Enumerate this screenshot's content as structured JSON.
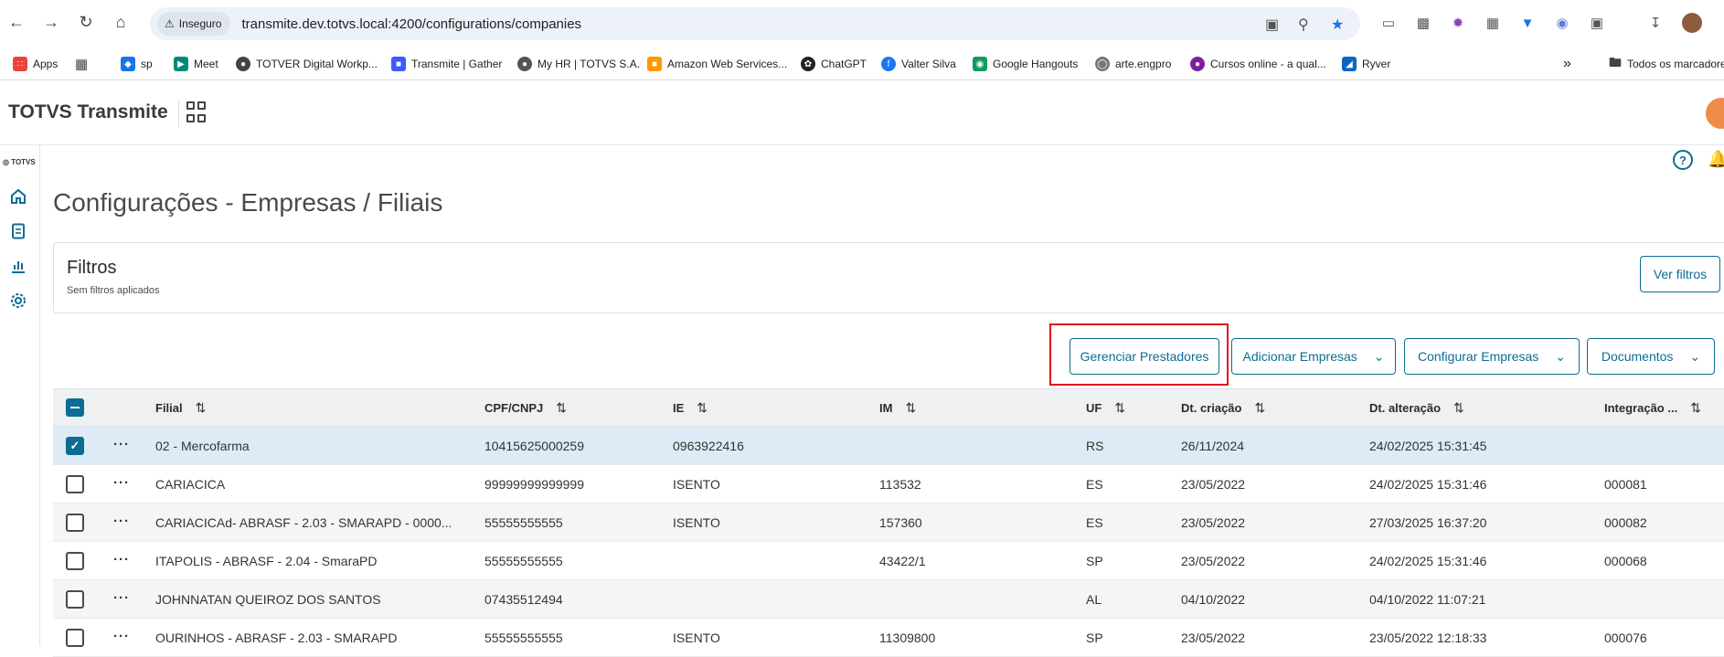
{
  "browser": {
    "security_label": "Inseguro",
    "url": "transmite.dev.totvs.local:4200/configurations/companies",
    "bookmarks": [
      {
        "label": "Apps",
        "color": "#e8453c"
      },
      {
        "label": "sp",
        "color": "#1a73e8"
      },
      {
        "label": "Meet",
        "color": "#00897b"
      },
      {
        "label": "TOTVER Digital Workp...",
        "color": "#444444"
      },
      {
        "label": "Transmite | Gather",
        "color": "#3d5afe"
      },
      {
        "label": "My HR | TOTVS S.A.",
        "color": "#555555"
      },
      {
        "label": "Amazon Web Services...",
        "color": "#ff9900"
      },
      {
        "label": "ChatGPT",
        "color": "#222222"
      },
      {
        "label": "Valter Silva",
        "color": "#1877f2"
      },
      {
        "label": "Google Hangouts",
        "color": "#0f9d58"
      },
      {
        "label": "arte.engpro",
        "color": "#777777"
      },
      {
        "label": "Cursos online - a qual...",
        "color": "#7b1fa2"
      },
      {
        "label": "Ryver",
        "color": "#0a66c2"
      }
    ],
    "bookmarks_folder": "Todos os marcadores"
  },
  "app": {
    "title": "TOTVS Transmite",
    "side_logo": "TOTVS"
  },
  "page": {
    "title": "Configurações - Empresas / Filiais"
  },
  "filters": {
    "title": "Filtros",
    "subtitle": "Sem filtros aplicados",
    "view_button": "Ver filtros"
  },
  "actions": {
    "manage_providers": "Gerenciar Prestadores",
    "add_companies": "Adicionar Empresas",
    "configure_companies": "Configurar Empresas",
    "documents": "Documentos"
  },
  "table": {
    "columns": [
      "Filial",
      "CPF/CNPJ",
      "IE",
      "IM",
      "UF",
      "Dt. criação",
      "Dt. alteração",
      "Integração ..."
    ],
    "rows": [
      {
        "filial": "02 - Mercofarma",
        "cnpj": "10415625000259",
        "ie": "0963922416",
        "im": "",
        "uf": "RS",
        "created": "26/11/2024",
        "updated": "24/02/2025 15:31:45",
        "integration": "",
        "selected": true
      },
      {
        "filial": "CARIACICA",
        "cnpj": "99999999999999",
        "ie": "ISENTO",
        "im": "113532",
        "uf": "ES",
        "created": "23/05/2022",
        "updated": "24/02/2025 15:31:46",
        "integration": "000081",
        "selected": false
      },
      {
        "filial": "CARIACICAd- ABRASF - 2.03 - SMARAPD - 0000...",
        "cnpj": "55555555555",
        "ie": "ISENTO",
        "im": "157360",
        "uf": "ES",
        "created": "23/05/2022",
        "updated": "27/03/2025 16:37:20",
        "integration": "000082",
        "selected": false
      },
      {
        "filial": "ITAPOLIS - ABRASF - 2.04 - SmaraPD",
        "cnpj": "55555555555",
        "ie": "",
        "im": "43422/1",
        "uf": "SP",
        "created": "23/05/2022",
        "updated": "24/02/2025 15:31:46",
        "integration": "000068",
        "selected": false
      },
      {
        "filial": "JOHNNATAN QUEIROZ DOS SANTOS",
        "cnpj": "07435512494",
        "ie": "",
        "im": "",
        "uf": "AL",
        "created": "04/10/2022",
        "updated": "04/10/2022 11:07:21",
        "integration": "",
        "selected": false
      },
      {
        "filial": "OURINHOS - ABRASF - 2.03 - SMARAPD",
        "cnpj": "55555555555",
        "ie": "ISENTO",
        "im": "11309800",
        "uf": "SP",
        "created": "23/05/2022",
        "updated": "23/05/2022 12:18:33",
        "integration": "000076",
        "selected": false
      }
    ]
  },
  "colors": {
    "primary": "#0c6c94",
    "highlight": "#e0101e",
    "selected_row": "#dcebf5"
  }
}
